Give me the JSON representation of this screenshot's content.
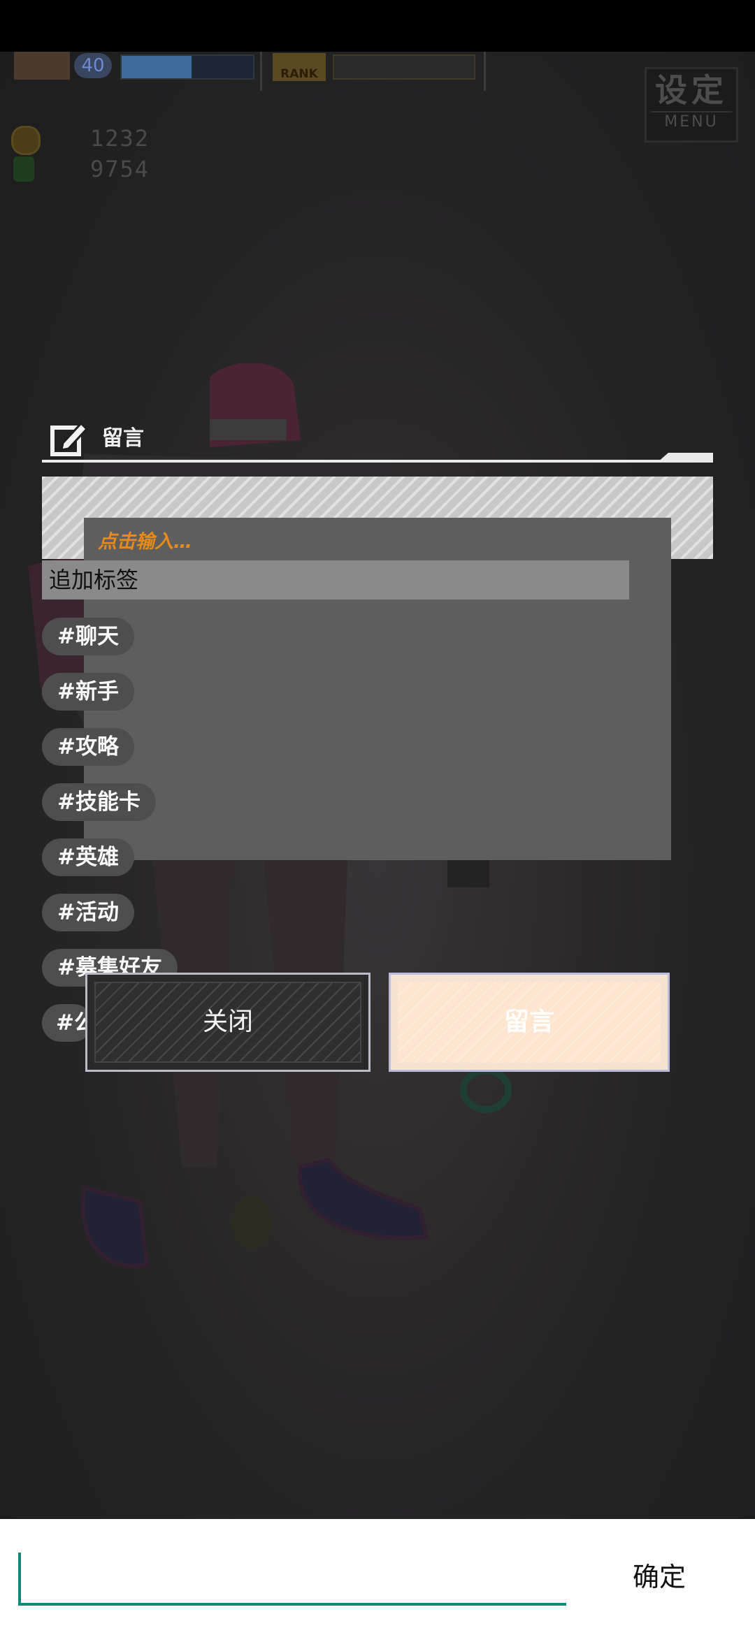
{
  "hud": {
    "level": "40",
    "rank_label": "RANK",
    "exp_progress": 0.53,
    "coins": "1232",
    "gems": "9754",
    "menu_big": "设定",
    "menu_small": "MENU"
  },
  "dialog": {
    "title": "留言",
    "placeholder": "点击输入…",
    "tag_header": "追加标签",
    "tags": [
      "#聊天",
      "#新手",
      "#攻略",
      "#技能卡",
      "#英雄",
      "#活动",
      "#募集好友",
      "#公"
    ],
    "close_label": "关闭",
    "post_label": "留言"
  },
  "ime": {
    "value": "",
    "confirm_label": "确定"
  },
  "colors": {
    "accent_teal": "#0f8a7a",
    "placeholder_orange": "#e58a1b",
    "post_button_fill": "#fde5cf"
  }
}
